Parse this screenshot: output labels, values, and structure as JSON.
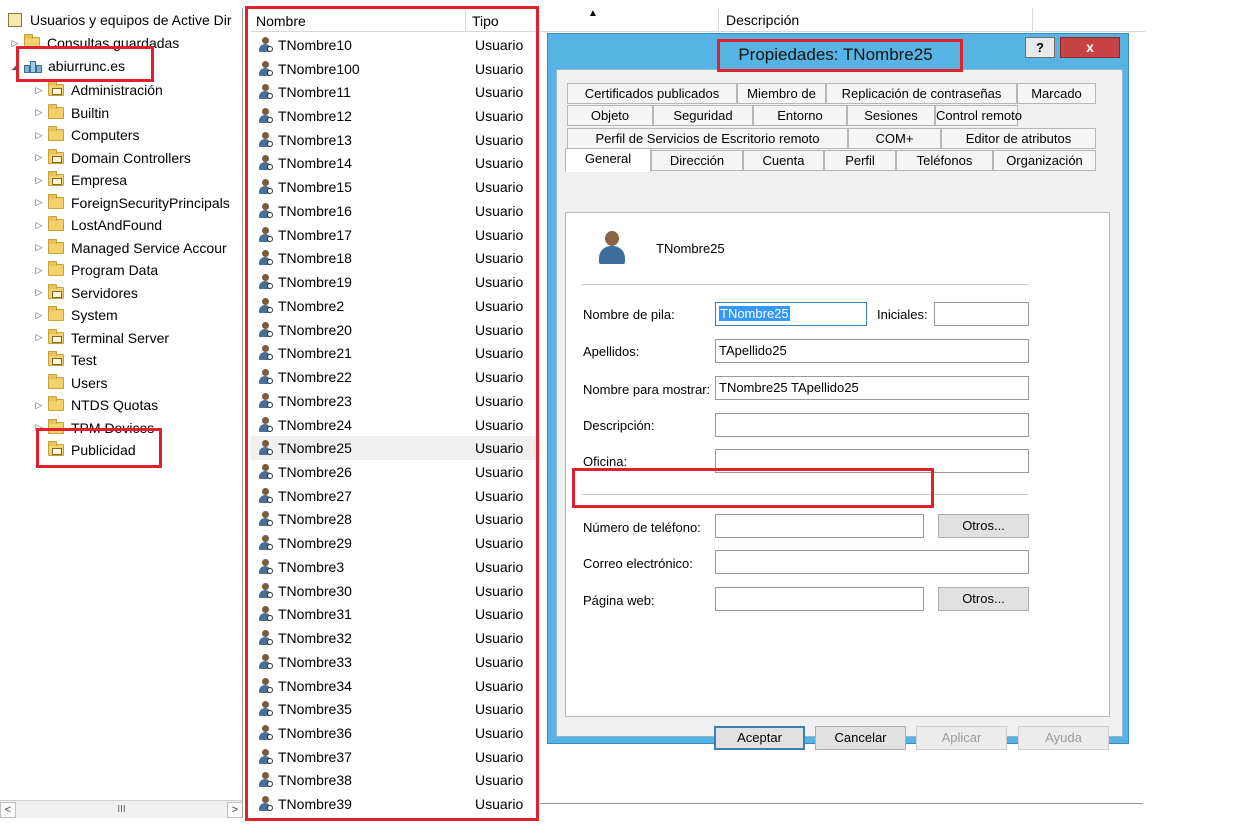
{
  "tree": {
    "root_label": "Usuarios y equipos de Active Dir",
    "saved_queries": "Consultas guardadas",
    "domain": "abiurrunc.es",
    "ous": [
      {
        "label": "Administración",
        "expandable": true,
        "ou": true
      },
      {
        "label": "Builtin",
        "expandable": true,
        "ou": false
      },
      {
        "label": "Computers",
        "expandable": true,
        "ou": false
      },
      {
        "label": "Domain Controllers",
        "expandable": true,
        "ou": true
      },
      {
        "label": "Empresa",
        "expandable": true,
        "ou": true
      },
      {
        "label": "ForeignSecurityPrincipals",
        "expandable": true,
        "ou": false
      },
      {
        "label": "LostAndFound",
        "expandable": true,
        "ou": false
      },
      {
        "label": "Managed Service Accour",
        "expandable": true,
        "ou": false
      },
      {
        "label": "Program Data",
        "expandable": true,
        "ou": false
      },
      {
        "label": "Servidores",
        "expandable": true,
        "ou": true
      },
      {
        "label": "System",
        "expandable": true,
        "ou": false
      },
      {
        "label": "Terminal Server",
        "expandable": true,
        "ou": true
      },
      {
        "label": "Test",
        "expandable": false,
        "ou": true
      },
      {
        "label": "Users",
        "expandable": false,
        "ou": false
      },
      {
        "label": "NTDS Quotas",
        "expandable": true,
        "ou": false
      },
      {
        "label": "TPM Devices",
        "expandable": true,
        "ou": false
      },
      {
        "label": "Publicidad",
        "expandable": false,
        "ou": true
      }
    ],
    "scroll_thumb": "III"
  },
  "list": {
    "col_name": "Nombre",
    "col_type": "Tipo",
    "col_description": "Descripción",
    "selected": "TNombre25",
    "rows": [
      {
        "name": "TNombre10",
        "type": "Usuario"
      },
      {
        "name": "TNombre100",
        "type": "Usuario"
      },
      {
        "name": "TNombre11",
        "type": "Usuario"
      },
      {
        "name": "TNombre12",
        "type": "Usuario"
      },
      {
        "name": "TNombre13",
        "type": "Usuario"
      },
      {
        "name": "TNombre14",
        "type": "Usuario"
      },
      {
        "name": "TNombre15",
        "type": "Usuario"
      },
      {
        "name": "TNombre16",
        "type": "Usuario"
      },
      {
        "name": "TNombre17",
        "type": "Usuario"
      },
      {
        "name": "TNombre18",
        "type": "Usuario"
      },
      {
        "name": "TNombre19",
        "type": "Usuario"
      },
      {
        "name": "TNombre2",
        "type": "Usuario"
      },
      {
        "name": "TNombre20",
        "type": "Usuario"
      },
      {
        "name": "TNombre21",
        "type": "Usuario"
      },
      {
        "name": "TNombre22",
        "type": "Usuario"
      },
      {
        "name": "TNombre23",
        "type": "Usuario"
      },
      {
        "name": "TNombre24",
        "type": "Usuario"
      },
      {
        "name": "TNombre25",
        "type": "Usuario"
      },
      {
        "name": "TNombre26",
        "type": "Usuario"
      },
      {
        "name": "TNombre27",
        "type": "Usuario"
      },
      {
        "name": "TNombre28",
        "type": "Usuario"
      },
      {
        "name": "TNombre29",
        "type": "Usuario"
      },
      {
        "name": "TNombre3",
        "type": "Usuario"
      },
      {
        "name": "TNombre30",
        "type": "Usuario"
      },
      {
        "name": "TNombre31",
        "type": "Usuario"
      },
      {
        "name": "TNombre32",
        "type": "Usuario"
      },
      {
        "name": "TNombre33",
        "type": "Usuario"
      },
      {
        "name": "TNombre34",
        "type": "Usuario"
      },
      {
        "name": "TNombre35",
        "type": "Usuario"
      },
      {
        "name": "TNombre36",
        "type": "Usuario"
      },
      {
        "name": "TNombre37",
        "type": "Usuario"
      },
      {
        "name": "TNombre38",
        "type": "Usuario"
      },
      {
        "name": "TNombre39",
        "type": "Usuario"
      }
    ]
  },
  "dialog": {
    "title": "Propiedades: TNombre25",
    "help_label": "?",
    "close_label": "x",
    "tabs_row1": [
      "Certificados publicados",
      "Miembro de",
      "Replicación de contraseñas",
      "Marcado"
    ],
    "tabs_row2": [
      "Objeto",
      "Seguridad",
      "Entorno",
      "Sesiones",
      "Control remoto"
    ],
    "tabs_row3": [
      "Perfil de Servicios de Escritorio remoto",
      "COM+",
      "Editor de atributos"
    ],
    "tabs_row4": [
      "General",
      "Dirección",
      "Cuenta",
      "Perfil",
      "Teléfonos",
      "Organización"
    ],
    "active_tab": "General",
    "display_user": "TNombre25",
    "fields": {
      "first_name_label": "Nombre de pila:",
      "first_name_value": "TNombre25",
      "initials_label": "Iniciales:",
      "initials_value": "",
      "last_name_label": "Apellidos:",
      "last_name_value": "TApellido25",
      "display_name_label": "Nombre para mostrar:",
      "display_name_value": "TNombre25 TApellido25",
      "description_label": "Descripción:",
      "description_value": "",
      "office_label": "Oficina:",
      "office_value": "",
      "phone_label": "Número de teléfono:",
      "phone_value": "",
      "email_label": "Correo electrónico:",
      "email_value": "",
      "web_label": "Página web:",
      "web_value": "",
      "others_label": "Otros..."
    },
    "buttons": {
      "ok": "Aceptar",
      "cancel": "Cancelar",
      "apply": "Aplicar",
      "help": "Ayuda"
    }
  },
  "colors": {
    "highlight": "#e0202a",
    "dialog_frame": "#56b3e4",
    "close_button": "#c74343"
  }
}
